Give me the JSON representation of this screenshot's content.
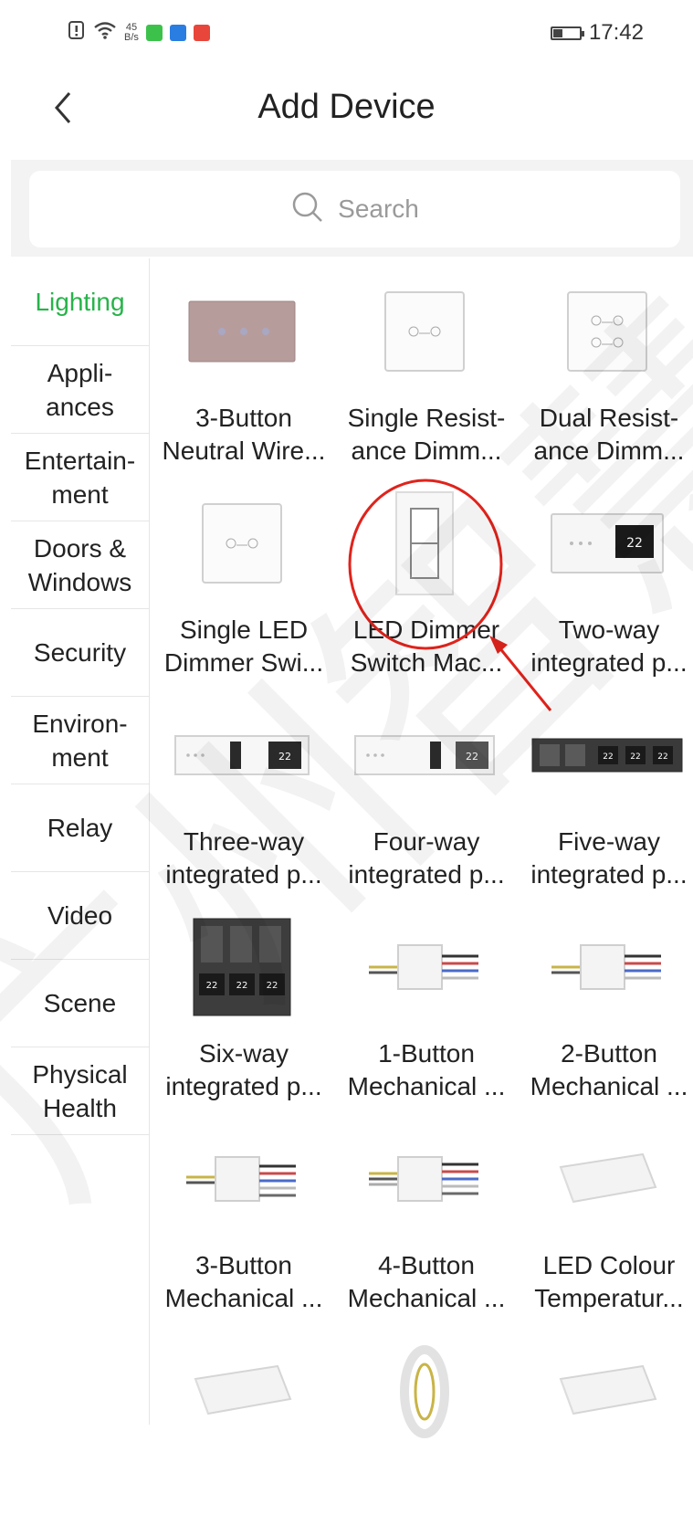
{
  "status_bar": {
    "speed_value": "45",
    "speed_unit": "B/s",
    "time": "17:42"
  },
  "header": {
    "title": "Add Device"
  },
  "search": {
    "placeholder": "Search"
  },
  "colors": {
    "accent": "#27b34a",
    "annotation": "#e0231c"
  },
  "categories": [
    {
      "label": "Lighting",
      "active": true
    },
    {
      "label": "Appli-\nances"
    },
    {
      "label": "Entertain-\nment"
    },
    {
      "label": "Doors &\nWindows"
    },
    {
      "label": "Security"
    },
    {
      "label": "Environ-\nment"
    },
    {
      "label": "Relay"
    },
    {
      "label": "Video"
    },
    {
      "label": "Scene"
    },
    {
      "label": "Physical\nHealth"
    }
  ],
  "devices": [
    {
      "label": "3-Button\nNeutral Wire...",
      "icon": "3-button-panel-icon"
    },
    {
      "label": "Single Resist-\nance Dimm...",
      "icon": "single-dimmer-panel-icon"
    },
    {
      "label": "Dual Resist-\nance Dimm...",
      "icon": "dual-dimmer-panel-icon"
    },
    {
      "label": "Single LED\nDimmer Swi...",
      "icon": "led-dimmer-panel-icon"
    },
    {
      "label": "LED Dimmer\nSwitch Mac...",
      "icon": "rocker-switch-icon"
    },
    {
      "label": "Two-way\nintegrated p...",
      "icon": "two-way-panel-icon",
      "display": "22"
    },
    {
      "label": "Three-way\nintegrated p...",
      "icon": "three-way-panel-icon",
      "display": "22"
    },
    {
      "label": "Four-way\nintegrated p...",
      "icon": "four-way-panel-icon",
      "display": "22"
    },
    {
      "label": "Five-way\nintegrated p...",
      "icon": "five-way-panel-icon",
      "display": "22"
    },
    {
      "label": "Six-way\nintegrated p...",
      "icon": "six-way-panel-icon",
      "display": "22"
    },
    {
      "label": "1-Button\nMechanical ...",
      "icon": "wired-module-icon"
    },
    {
      "label": "2-Button\nMechanical ...",
      "icon": "wired-module-icon"
    },
    {
      "label": "3-Button\nMechanical ...",
      "icon": "wired-module-icon"
    },
    {
      "label": "4-Button\nMechanical ...",
      "icon": "wired-module-icon"
    },
    {
      "label": "LED Colour\nTemperatur...",
      "icon": "led-driver-icon"
    },
    {
      "label": "",
      "icon": "led-driver-icon"
    },
    {
      "label": "",
      "icon": "led-strip-icon"
    },
    {
      "label": "",
      "icon": "led-driver-icon"
    }
  ],
  "watermark": "广州智慧"
}
